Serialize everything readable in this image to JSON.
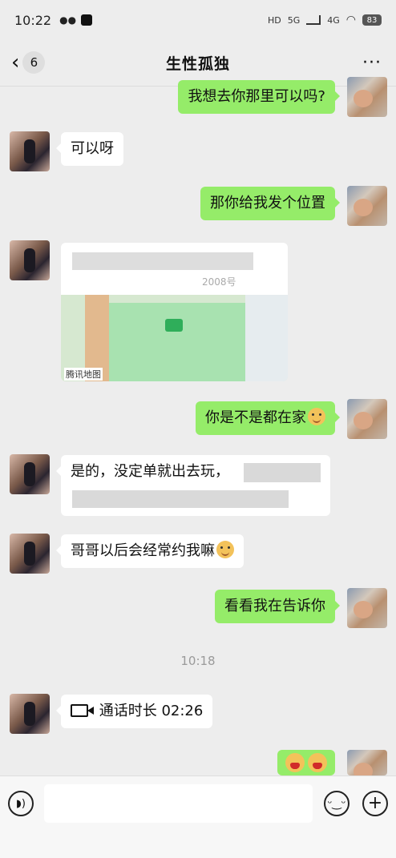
{
  "status_bar": {
    "time": "10:22",
    "battery": "83",
    "network_labels": [
      "HD",
      "5G",
      "4G"
    ]
  },
  "header": {
    "back_count": "6",
    "title": "生性孤独",
    "more": "···"
  },
  "messages": [
    {
      "side": "out",
      "text": "我想去你那里可以吗?"
    },
    {
      "side": "in",
      "text": "可以呀"
    },
    {
      "side": "out",
      "text": "那你给我发个位置"
    },
    {
      "side": "in",
      "type": "location",
      "partial_text": "2008号",
      "map_provider": "腾讯地图"
    },
    {
      "side": "out",
      "text": "你是不是都在家",
      "emoji": "doge-emoji"
    },
    {
      "side": "in",
      "text": "是的，没定单就出去玩，"
    },
    {
      "side": "in",
      "text": "哥哥以后会经常约我嘛",
      "emoji": "doge-emoji"
    },
    {
      "side": "out",
      "text": "看看我在告诉你"
    },
    {
      "side": "in",
      "type": "call",
      "text": "通话时长 02:26"
    },
    {
      "side": "out",
      "type": "emoji",
      "emojis": [
        "shocked-emoji",
        "shocked-emoji"
      ]
    }
  ],
  "timestamp": "10:18",
  "input_bar": {
    "placeholder": "",
    "voice_icon": "voice-icon",
    "emoji_icon": "smile-icon",
    "plus_icon": "plus-icon"
  },
  "colors": {
    "background": "#ededed",
    "outgoing_bubble": "#95ec69",
    "incoming_bubble": "#ffffff"
  }
}
